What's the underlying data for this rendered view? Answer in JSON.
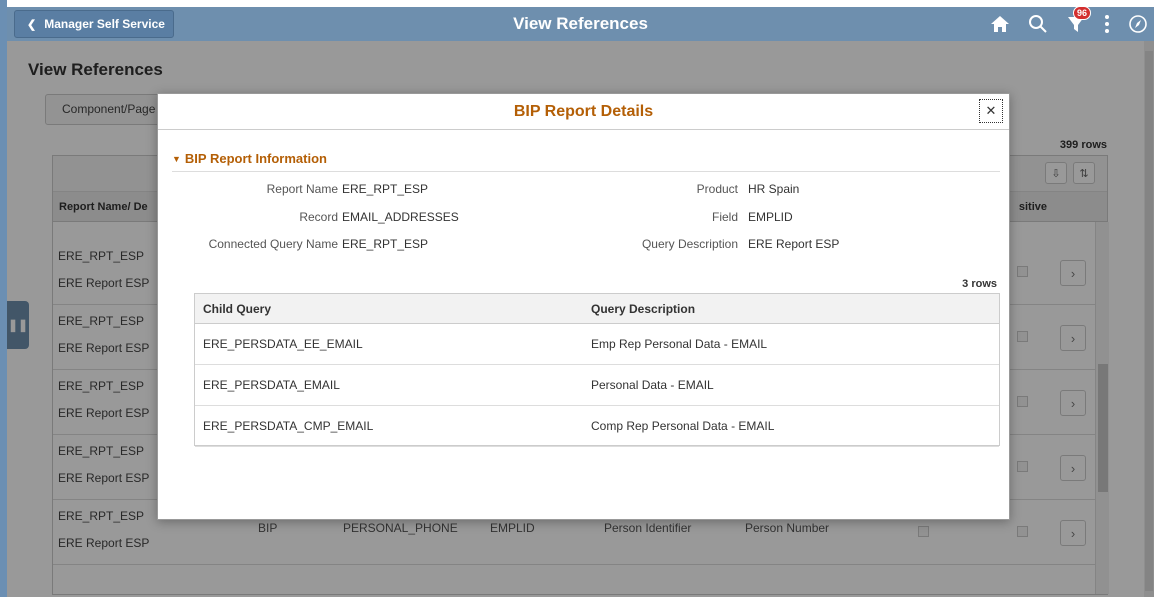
{
  "banner": {
    "back_label": "Manager Self Service",
    "title": "View References",
    "notification_count": "96",
    "icons": [
      "home-icon",
      "search-icon",
      "notifications-icon",
      "actions-menu-icon",
      "navbar-icon"
    ]
  },
  "page": {
    "title": "View References",
    "tab_label": "Component/Page",
    "rows_count": "399 rows",
    "grid": {
      "header_col1": "Report Name/ De",
      "header_sensitive": "sitive",
      "rows": [
        {
          "name": "ERE_RPT_ESP",
          "desc": "ERE Report ESP"
        },
        {
          "name": "ERE_RPT_ESP",
          "desc": "ERE Report ESP"
        },
        {
          "name": "ERE_RPT_ESP",
          "desc": "ERE Report ESP"
        },
        {
          "name": "ERE_RPT_ESP",
          "desc": "ERE Report ESP"
        },
        {
          "name": "ERE_RPT_ESP",
          "desc": "ERE Report ESP",
          "type": "BIP",
          "record": "PERSONAL_PHONE",
          "field": "EMPLID",
          "label1": "Person Identifier",
          "label2": "Person Number"
        }
      ]
    }
  },
  "modal": {
    "title": "BIP Report Details",
    "section_title": "BIP Report Information",
    "fields": {
      "report_name_label": "Report Name",
      "report_name": "ERE_RPT_ESP",
      "product_label": "Product",
      "product": "HR Spain",
      "record_label": "Record",
      "record": "EMAIL_ADDRESSES",
      "field_label": "Field",
      "field": "EMPLID",
      "connected_query_label": "Connected Query Name",
      "connected_query": "ERE_RPT_ESP",
      "query_desc_label": "Query Description",
      "query_desc": "ERE Report ESP"
    },
    "child_rows_count": "3 rows",
    "child_grid": {
      "col1": "Child Query",
      "col2": "Query Description",
      "rows": [
        {
          "query": "ERE_PERSDATA_EE_EMAIL",
          "desc": "Emp Rep Personal Data - EMAIL"
        },
        {
          "query": "ERE_PERSDATA_EMAIL",
          "desc": "Personal Data - EMAIL"
        },
        {
          "query": "ERE_PERSDATA_CMP_EMAIL",
          "desc": "Comp Rep Personal Data - EMAIL"
        }
      ]
    }
  },
  "colors": {
    "banner": "#6e8fae",
    "accent": "#b45f06",
    "badge": "#d32f2f"
  }
}
